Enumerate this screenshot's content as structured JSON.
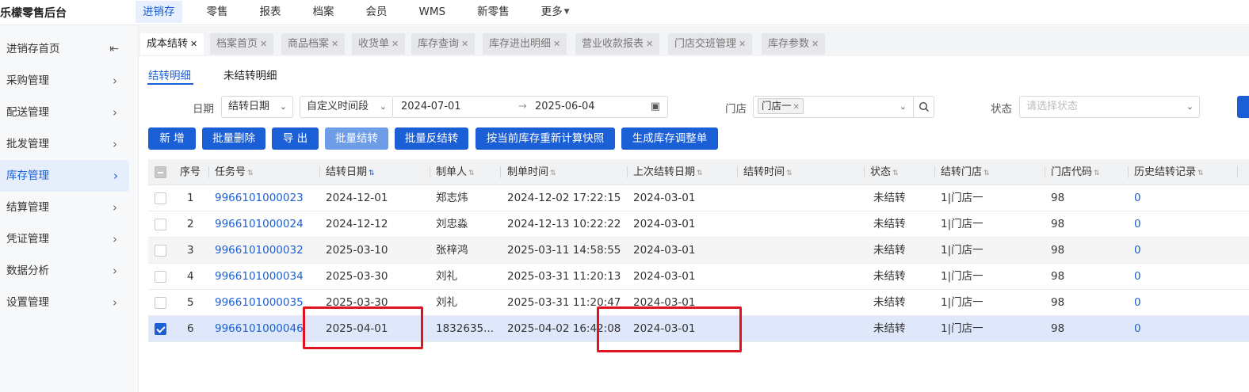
{
  "brand": "乐檬零售后台",
  "top_nav": [
    {
      "label": "进销存",
      "active": true
    },
    {
      "label": "零售"
    },
    {
      "label": "报表"
    },
    {
      "label": "档案"
    },
    {
      "label": "会员"
    },
    {
      "label": "WMS"
    },
    {
      "label": "新零售"
    },
    {
      "label": "更多",
      "dropdown": true
    }
  ],
  "sidebar": {
    "items": [
      {
        "label": "进销存首页",
        "icon": "collapse-icon"
      },
      {
        "label": "采购管理"
      },
      {
        "label": "配送管理"
      },
      {
        "label": "批发管理"
      },
      {
        "label": "库存管理",
        "active": true
      },
      {
        "label": "结算管理"
      },
      {
        "label": "凭证管理"
      },
      {
        "label": "数据分析"
      },
      {
        "label": "设置管理"
      }
    ]
  },
  "tabs": [
    {
      "label": "成本结转",
      "active": true
    },
    {
      "label": "档案首页"
    },
    {
      "label": "商品档案"
    },
    {
      "label": "收货单"
    },
    {
      "label": "库存查询"
    },
    {
      "label": "库存进出明细"
    },
    {
      "label": "营业收款报表"
    },
    {
      "label": "门店交班管理"
    },
    {
      "label": "库存参数"
    }
  ],
  "subtabs": [
    {
      "label": "结转明细",
      "active": true
    },
    {
      "label": "未结转明细"
    }
  ],
  "filters": {
    "date_label": "日期",
    "date_type": "结转日期",
    "period": "自定义时间段",
    "start_date": "2024-07-01",
    "range_sep": "→",
    "end_date": "2025-06-04",
    "store_label": "门店",
    "store_chip": "门店一",
    "status_label": "状态",
    "status_placeholder": "请选择状态"
  },
  "buttons": {
    "add": "新 增",
    "batch_delete": "批量删除",
    "export": "导 出",
    "batch_carry": "批量结转",
    "batch_reverse": "批量反结转",
    "recalc": "按当前库存重新计算快照",
    "gen_adjust": "生成库存调整单"
  },
  "table": {
    "headers": {
      "seq": "序号",
      "task_no": "任务号",
      "carry_date": "结转日期",
      "creator": "制单人",
      "create_time": "制单时间",
      "last_carry_date": "上次结转日期",
      "carry_time": "结转时间",
      "status": "状态",
      "store": "结转门店",
      "store_code": "门店代码",
      "history": "历史结转记录"
    },
    "rows": [
      {
        "seq": "1",
        "task_no": "9966101000023",
        "carry_date": "2024-12-01",
        "creator": "郑志炜",
        "create_time": "2024-12-02 17:22:15",
        "last_carry_date": "2024-03-01",
        "carry_time": "",
        "status": "未结转",
        "store": "1|门店一",
        "store_code": "98",
        "history": "0",
        "checked": false
      },
      {
        "seq": "2",
        "task_no": "9966101000024",
        "carry_date": "2024-12-12",
        "creator": "刘忠淼",
        "create_time": "2024-12-13 10:22:22",
        "last_carry_date": "2024-03-01",
        "carry_time": "",
        "status": "未结转",
        "store": "1|门店一",
        "store_code": "98",
        "history": "0",
        "checked": false
      },
      {
        "seq": "3",
        "task_no": "9966101000032",
        "carry_date": "2025-03-10",
        "creator": "张梓鸿",
        "create_time": "2025-03-11 14:58:55",
        "last_carry_date": "2024-03-01",
        "carry_time": "",
        "status": "未结转",
        "store": "1|门店一",
        "store_code": "98",
        "history": "0",
        "checked": false
      },
      {
        "seq": "4",
        "task_no": "9966101000034",
        "carry_date": "2025-03-30",
        "creator": "刘礼",
        "create_time": "2025-03-31 11:20:13",
        "last_carry_date": "2024-03-01",
        "carry_time": "",
        "status": "未结转",
        "store": "1|门店一",
        "store_code": "98",
        "history": "0",
        "checked": false
      },
      {
        "seq": "5",
        "task_no": "9966101000035",
        "carry_date": "2025-03-30",
        "creator": "刘礼",
        "create_time": "2025-03-31 11:20:47",
        "last_carry_date": "2024-03-01",
        "carry_time": "",
        "status": "未结转",
        "store": "1|门店一",
        "store_code": "98",
        "history": "0",
        "checked": false
      },
      {
        "seq": "6",
        "task_no": "9966101000046",
        "carry_date": "2025-04-01",
        "creator": "1832635...",
        "create_time": "2025-04-02 16:42:08",
        "last_carry_date": "2024-03-01",
        "carry_time": "",
        "status": "未结转",
        "store": "1|门店一",
        "store_code": "98",
        "history": "0",
        "checked": true
      }
    ]
  },
  "colors": {
    "accent": "#1a5fd6",
    "annotation": "#e0141e"
  }
}
